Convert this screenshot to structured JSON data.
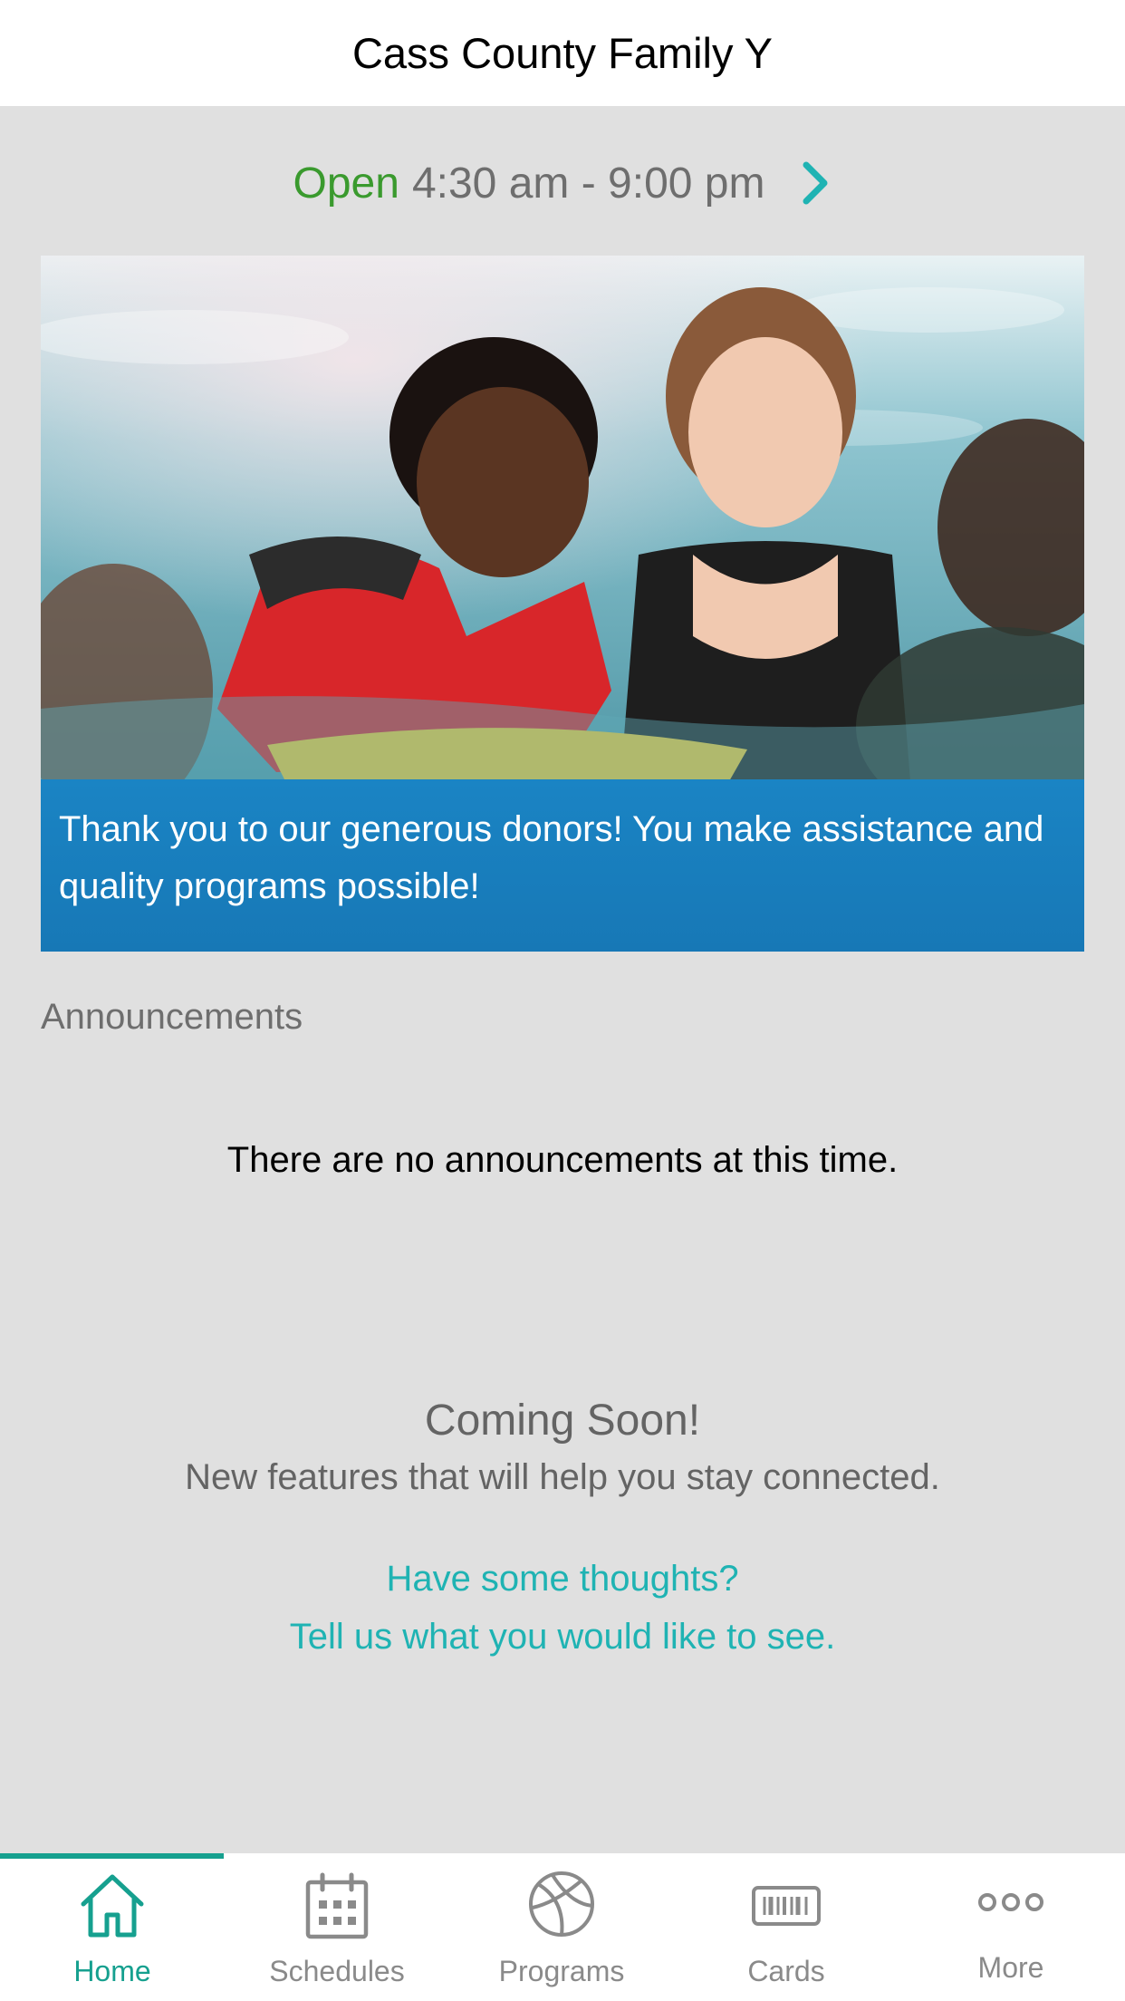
{
  "header": {
    "title": "Cass County Family Y"
  },
  "hours": {
    "status": "Open",
    "range": "4:30 am - 9:00 pm",
    "chevron_icon": "chevron-right-icon"
  },
  "hero": {
    "caption": "Thank you to our generous donors! You make assistance and quality programs possible!"
  },
  "announcements": {
    "heading": "Announcements",
    "empty_message": "There are no announcements at this time."
  },
  "coming_soon": {
    "title": "Coming Soon!",
    "subtitle": "New features that will help you stay connected.",
    "link_line1": "Have some thoughts?",
    "link_line2": "Tell us what you would like to see."
  },
  "tabbar": {
    "tabs": [
      {
        "label": "Home",
        "icon": "home-icon",
        "active": true
      },
      {
        "label": "Schedules",
        "icon": "calendar-icon",
        "active": false
      },
      {
        "label": "Programs",
        "icon": "basketball-icon",
        "active": false
      },
      {
        "label": "Cards",
        "icon": "barcode-card-icon",
        "active": false
      },
      {
        "label": "More",
        "icon": "more-dots-icon",
        "active": false
      }
    ]
  },
  "colors": {
    "open_green": "#3a9a2e",
    "accent_teal": "#16a08f",
    "link_teal": "#1fb3b3",
    "caption_blue": "#1a84c4",
    "background": "#e0e0e0"
  }
}
